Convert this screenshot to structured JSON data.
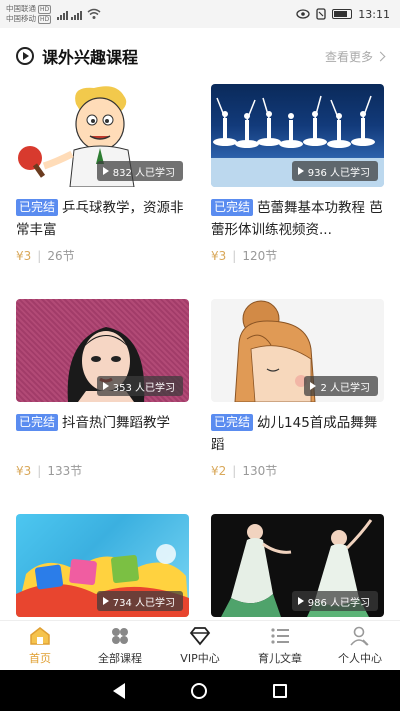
{
  "status_bar": {
    "carrier1": "中国联通",
    "carrier2": "中国移动",
    "carrier_tag": "HD",
    "time": "13:11"
  },
  "section": {
    "title": "课外兴趣课程",
    "more_label": "查看更多"
  },
  "courses": [
    {
      "status": "已完结",
      "title": "乒乓球教学，资源非常丰富",
      "learners": "832 人已学习",
      "price": "¥3",
      "lessons": "26节",
      "art": "pingpong"
    },
    {
      "status": "已完结",
      "title": "芭蕾舞基本功教程 芭蕾形体训练视频资...",
      "learners": "936 人已学习",
      "price": "¥3",
      "lessons": "120节",
      "art": "ballet"
    },
    {
      "status": "已完结",
      "title": "抖音热门舞蹈教学",
      "learners": "353 人已学习",
      "price": "¥3",
      "lessons": "133节",
      "art": "dance"
    },
    {
      "status": "已完结",
      "title": "幼儿145首成品舞舞蹈",
      "learners": "2 人已学习",
      "price": "¥2",
      "lessons": "130节",
      "art": "girl"
    },
    {
      "status": "",
      "title": "",
      "learners": "734 人已学习",
      "price": "",
      "lessons": "",
      "art": "cartoon"
    },
    {
      "status": "",
      "title": "",
      "learners": "986 人已学习",
      "price": "",
      "lessons": "",
      "art": "green"
    }
  ],
  "bottom_nav": [
    {
      "label": "首页",
      "icon": "home-icon",
      "active": true
    },
    {
      "label": "全部课程",
      "icon": "grid-icon",
      "active": false
    },
    {
      "label": "VIP中心",
      "icon": "diamond-icon",
      "active": false
    },
    {
      "label": "育儿文章",
      "icon": "list-icon",
      "active": false
    },
    {
      "label": "个人中心",
      "icon": "user-icon",
      "active": false
    }
  ],
  "colors": {
    "accent": "#e0a033",
    "badge": "#5a8cf0",
    "price": "#d9a85a"
  }
}
